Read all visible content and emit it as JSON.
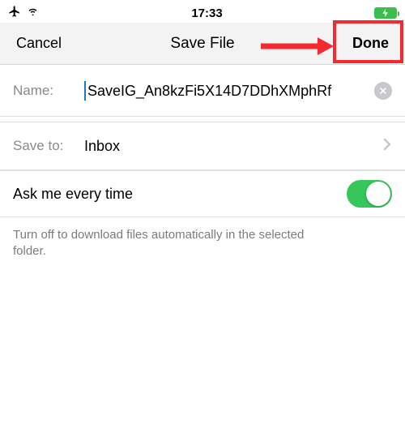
{
  "status": {
    "time": "17:33"
  },
  "nav": {
    "cancel": "Cancel",
    "title": "Save File",
    "done": "Done"
  },
  "name": {
    "label": "Name:",
    "value": "SaveIG_An8kzFi5X14D7DDhXMphRf"
  },
  "saveto": {
    "label": "Save to:",
    "value": "Inbox"
  },
  "toggle": {
    "label": "Ask me every time"
  },
  "hint": "Turn off to download files automatically in the selected folder."
}
